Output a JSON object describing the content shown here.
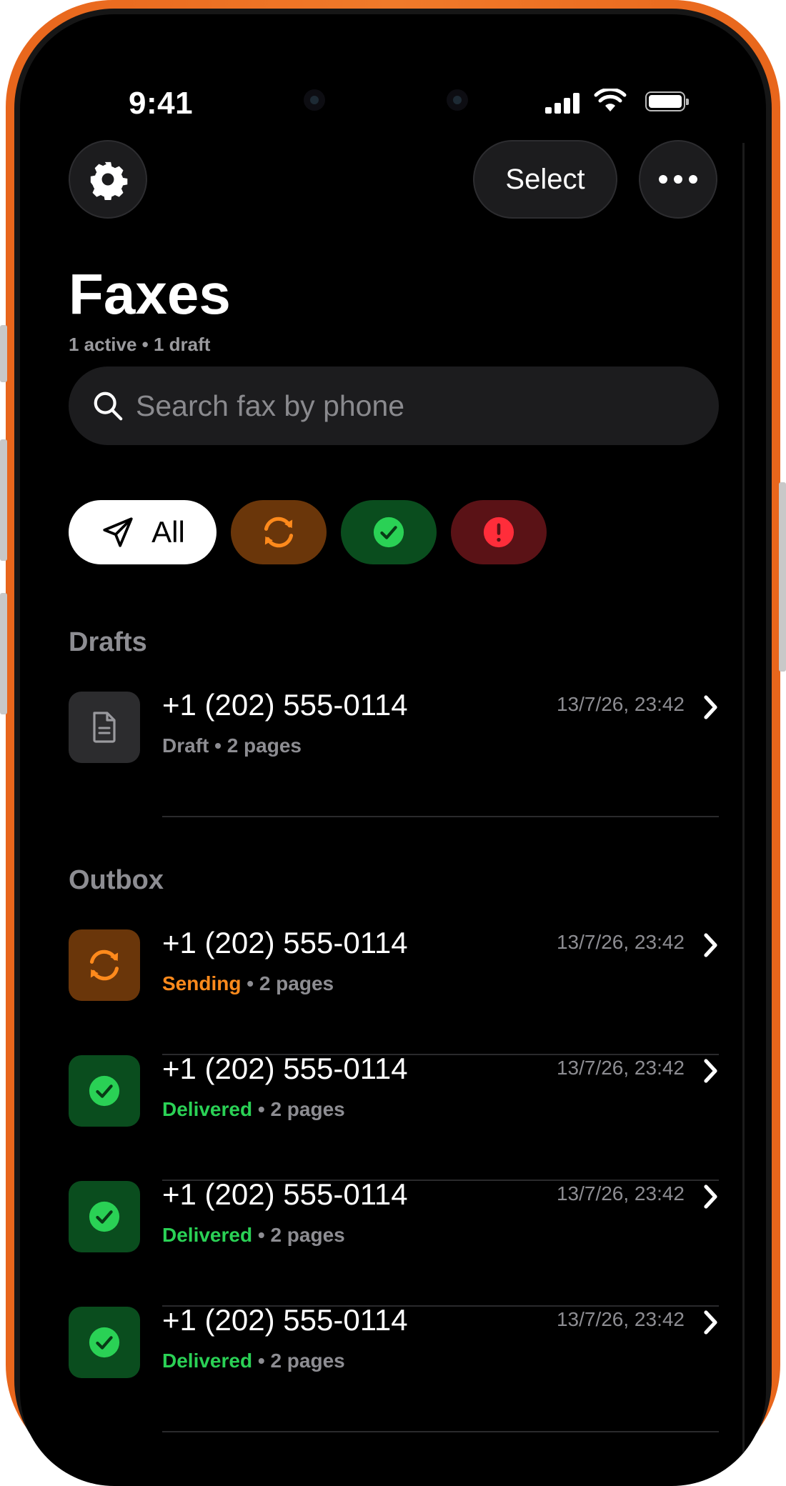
{
  "status_bar": {
    "time": "9:41"
  },
  "header": {
    "settings_icon": "gear-icon",
    "select_label": "Select",
    "more_icon": "ellipsis-icon",
    "title": "Faxes",
    "subtitle": "1 active • 1 draft"
  },
  "search": {
    "placeholder": "Search fax by phone"
  },
  "filters": {
    "all_label": "All",
    "all_icon": "send-icon",
    "sending_icon": "sync-icon",
    "delivered_icon": "checkmark-circle-icon",
    "failed_icon": "exclamation-circle-icon"
  },
  "drafts": {
    "title": "Drafts",
    "items": [
      {
        "phone": "+1 (202) 555-0114",
        "status": "Draft",
        "pages": " • 2 pages",
        "date": "13/7/26, 23:42",
        "icon": "document-icon"
      }
    ]
  },
  "outbox": {
    "title": "Outbox",
    "items": [
      {
        "phone": "+1 (202) 555-0114",
        "status": "Sending",
        "pages": " • 2 pages",
        "date": "13/7/26, 23:42",
        "icon": "sync-icon"
      },
      {
        "phone": "+1 (202) 555-0114",
        "status": "Delivered",
        "pages": " • 2 pages",
        "date": "13/7/26, 23:42",
        "icon": "checkmark-circle-icon"
      },
      {
        "phone": "+1 (202) 555-0114",
        "status": "Delivered",
        "pages": " • 2 pages",
        "date": "13/7/26, 23:42",
        "icon": "checkmark-circle-icon"
      },
      {
        "phone": "+1 (202) 555-0114",
        "status": "Delivered",
        "pages": " • 2 pages",
        "date": "13/7/26, 23:42",
        "icon": "checkmark-circle-icon"
      }
    ]
  },
  "colors": {
    "frame": "#e8661c",
    "sending": "#ff8a1c",
    "delivered": "#2ad155",
    "failed": "#ff2d3a"
  }
}
